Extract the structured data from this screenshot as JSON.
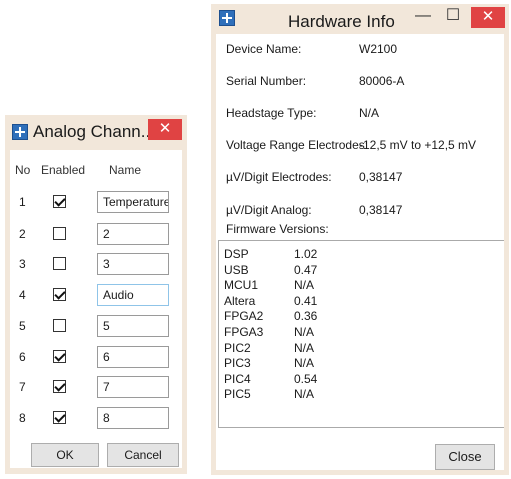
{
  "analog_window": {
    "title": "Analog Chann...",
    "close_symbol": "✕",
    "headers": {
      "no": "No",
      "enabled": "Enabled",
      "name": "Name"
    },
    "channels": [
      {
        "no": "1",
        "enabled": true,
        "name": "Temperature"
      },
      {
        "no": "2",
        "enabled": false,
        "name": "2"
      },
      {
        "no": "3",
        "enabled": false,
        "name": "3"
      },
      {
        "no": "4",
        "enabled": true,
        "name": "Audio"
      },
      {
        "no": "5",
        "enabled": false,
        "name": "5"
      },
      {
        "no": "6",
        "enabled": true,
        "name": "6"
      },
      {
        "no": "7",
        "enabled": true,
        "name": "7"
      },
      {
        "no": "8",
        "enabled": true,
        "name": "8"
      }
    ],
    "ok_label": "OK",
    "cancel_label": "Cancel"
  },
  "hardware_window": {
    "title": "Hardware Info",
    "minimize_symbol": "—",
    "maximize_symbol": "☐",
    "close_symbol": "✕",
    "fields": [
      {
        "label": "Device Name:",
        "value": "W2100"
      },
      {
        "label": "Serial Number:",
        "value": "80006-A"
      },
      {
        "label": "Headstage Type:",
        "value": "N/A"
      },
      {
        "label": "Voltage Range Electrodes:",
        "value": "-12,5 mV to +12,5 mV"
      },
      {
        "label": "µV/Digit Electrodes:",
        "value": "0,38147"
      },
      {
        "label": "µV/Digit Analog:",
        "value": "0,38147"
      }
    ],
    "firmware_label": "Firmware Versions:",
    "firmware": [
      {
        "name": "DSP",
        "version": "1.02"
      },
      {
        "name": "USB",
        "version": "0.47"
      },
      {
        "name": "MCU1",
        "version": "N/A"
      },
      {
        "name": "Altera",
        "version": "0.41"
      },
      {
        "name": "FPGA2",
        "version": "0.36"
      },
      {
        "name": "FPGA3",
        "version": "N/A"
      },
      {
        "name": "PIC2",
        "version": "N/A"
      },
      {
        "name": "PIC3",
        "version": "N/A"
      },
      {
        "name": "PIC4",
        "version": "0.54"
      },
      {
        "name": "PIC5",
        "version": "N/A"
      }
    ],
    "close_label": "Close"
  }
}
